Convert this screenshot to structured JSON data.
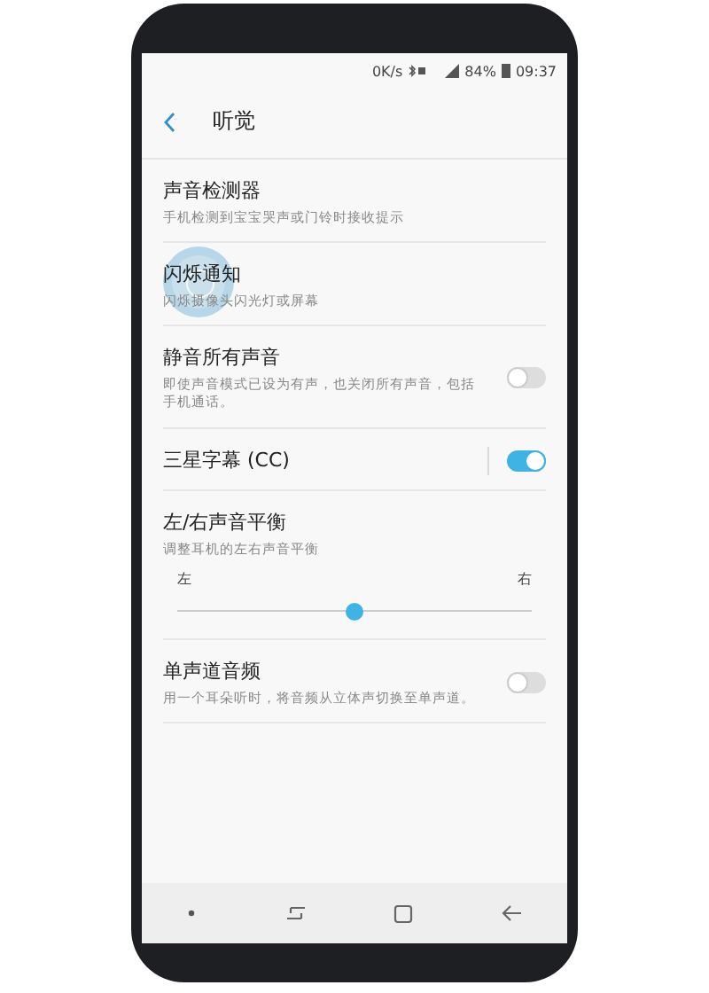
{
  "status_bar": {
    "speed": "0K/s",
    "battery": "84%",
    "time": "09:37"
  },
  "header": {
    "title": "听觉"
  },
  "items": [
    {
      "kind": "link",
      "title": "声音检测器",
      "subtitle": "手机检测到宝宝哭声或门铃时接收提示",
      "touched": false
    },
    {
      "kind": "link",
      "title": "闪烁通知",
      "subtitle": "闪烁摄像头闪光灯或屏幕",
      "touched": true
    },
    {
      "kind": "toggle",
      "title": "静音所有声音",
      "subtitle": "即使声音模式已设为有声，也关闭所有声音，包括手机通话。",
      "on": false,
      "touched": false
    },
    {
      "kind": "toggle",
      "title": "三星字幕 (CC)",
      "on": true,
      "touched": false
    },
    {
      "kind": "slider",
      "title": "左/右声音平衡",
      "subtitle": "调整耳机的左右声音平衡",
      "left": "左",
      "right": "右",
      "level": 0.5,
      "touched": false
    },
    {
      "kind": "toggle",
      "title": "单声道音频",
      "subtitle": "用一个耳朵听时，将音频从立体声切换至单声道。",
      "on": false,
      "touched": false
    }
  ]
}
